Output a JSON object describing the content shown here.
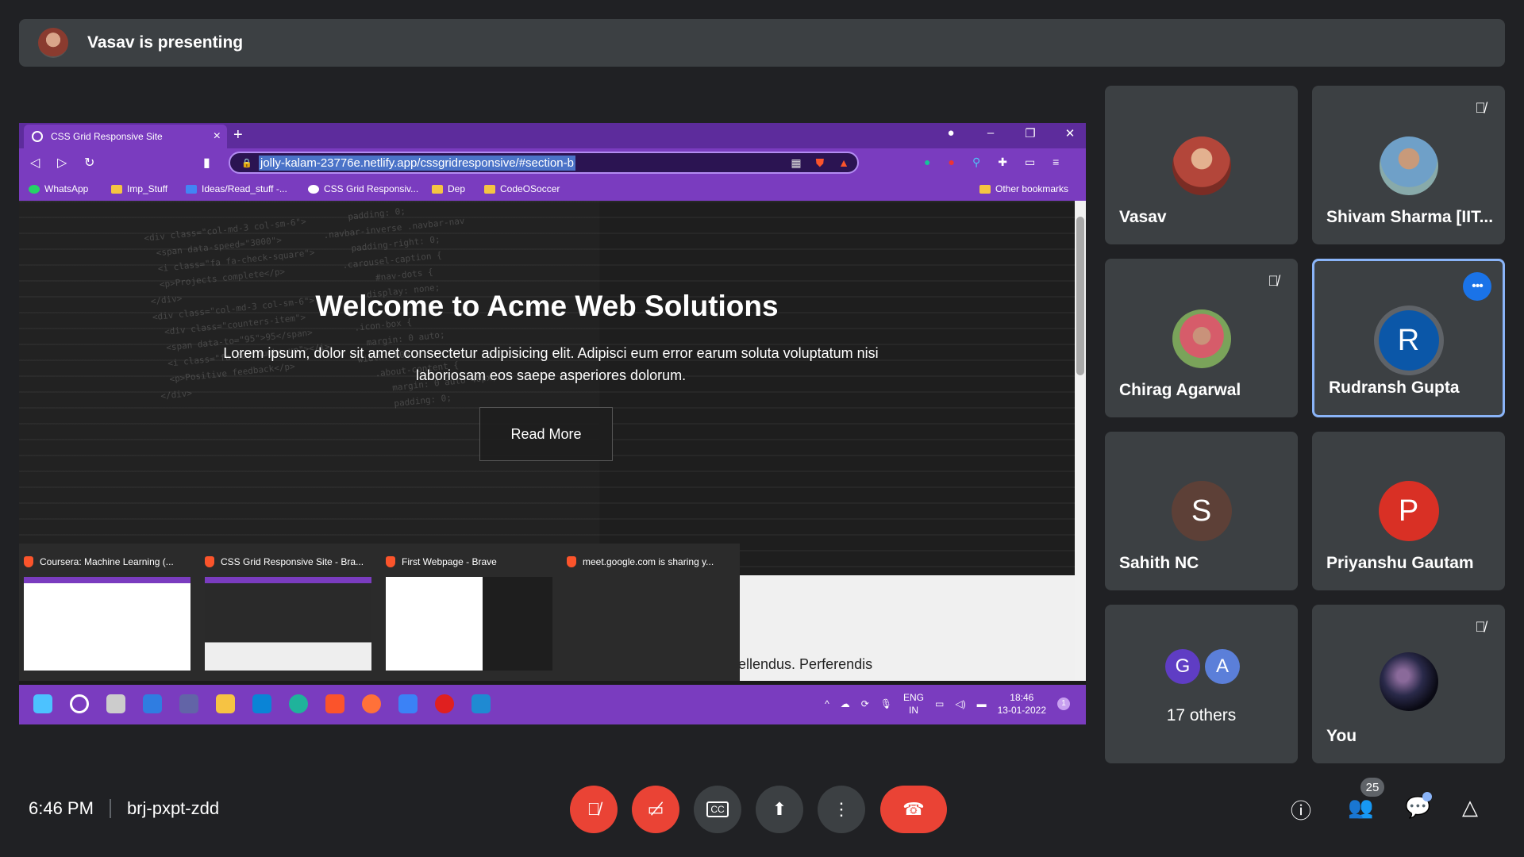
{
  "presenting": {
    "text": "Vasav is presenting"
  },
  "browser": {
    "tab_title": "CSS Grid Responsive Site",
    "url": "jolly-kalam-23776e.netlify.app/cssgridresponsive/#section-b",
    "bookmarks": [
      "WhatsApp",
      "Imp_Stuff",
      "Ideas/Read_stuff -...",
      "CSS Grid Responsiv...",
      "Dep",
      "CodeOSoccer"
    ],
    "other_bookmarks": "Other bookmarks"
  },
  "webpage": {
    "title": "Welcome to Acme Web Solutions",
    "text": "Lorem ipsum, dolor sit amet consectetur adipisicing elit. Adipisci eum error earum soluta voluptatum nisi laboriosam eos saepe asperiores dolorum.",
    "button": "Read More",
    "below_text": "ellendus. Perferendis"
  },
  "taskbar_previews": [
    "Coursera: Machine Learning (...",
    "CSS Grid Responsive Site - Bra...",
    "First Webpage - Brave",
    "meet.google.com is sharing y..."
  ],
  "taskbar": {
    "lang": "ENG",
    "region": "IN",
    "time": "18:46",
    "date": "13-01-2022",
    "notif": "1"
  },
  "participants": [
    {
      "name": "Vasav"
    },
    {
      "name": "Shivam Sharma [IIT..."
    },
    {
      "name": "Chirag Agarwal"
    },
    {
      "name": "Rudransh Gupta",
      "initial": "R"
    },
    {
      "name": "Sahith NC",
      "initial": "S"
    },
    {
      "name": "Priyanshu Gautam",
      "initial": "P"
    },
    {
      "others_label": "17 others",
      "initials": [
        "G",
        "A"
      ]
    },
    {
      "name": "You"
    }
  ],
  "meeting": {
    "time": "6:46 PM",
    "code": "brj-pxpt-zdd",
    "people_count": "25"
  },
  "colors": {
    "accent_red": "#ea4335",
    "tile": "#3c4043",
    "speaking": "#1a73e8",
    "browser_purple": "#7a3cbf"
  },
  "icons": {
    "controls": [
      "mic-off-icon",
      "camera-off-icon",
      "captions-icon",
      "present-icon",
      "more-icon",
      "hang-up-icon"
    ],
    "right": [
      "info-icon",
      "people-icon",
      "chat-icon",
      "activities-icon"
    ]
  }
}
